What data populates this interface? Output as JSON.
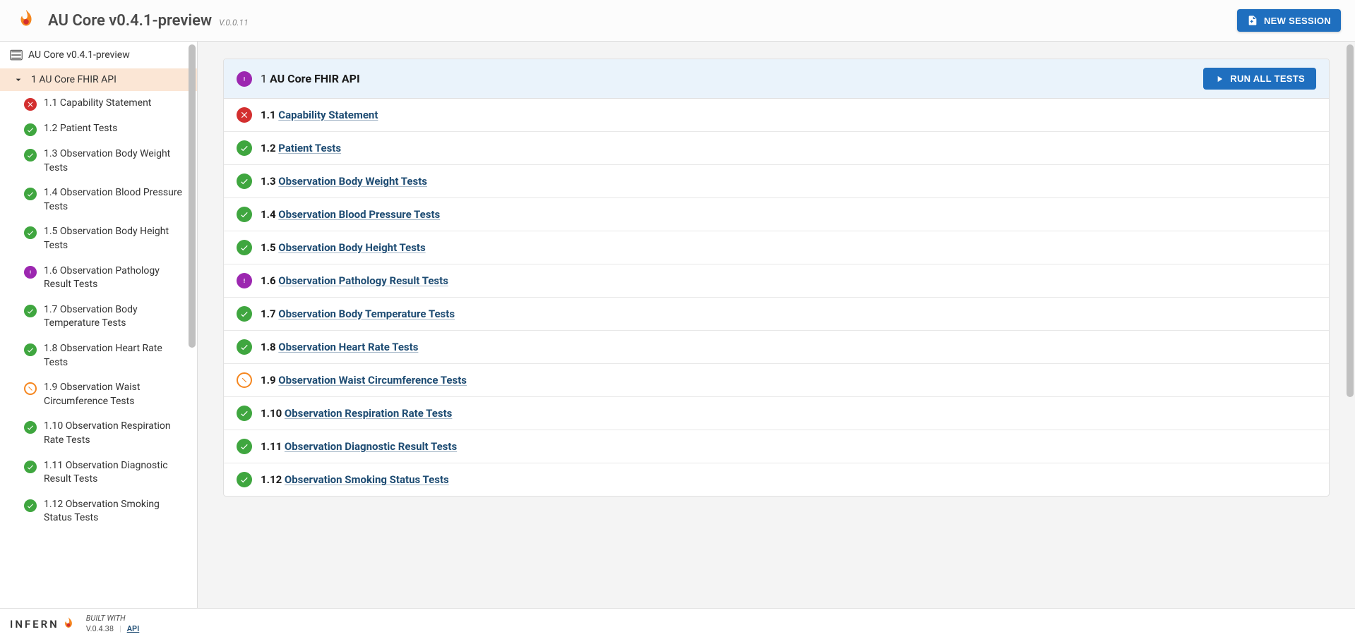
{
  "header": {
    "title": "AU Core v0.4.1-preview",
    "version": "V.0.0.11",
    "new_session": "NEW SESSION"
  },
  "sidebar": {
    "root": "AU Core v0.4.1-preview",
    "group": {
      "num": "1",
      "name": "AU Core FHIR API"
    },
    "items": [
      {
        "num": "1.1",
        "name": "Capability Statement",
        "status": "fail"
      },
      {
        "num": "1.2",
        "name": "Patient Tests",
        "status": "success"
      },
      {
        "num": "1.3",
        "name": "Observation Body Weight Tests",
        "status": "success"
      },
      {
        "num": "1.4",
        "name": "Observation Blood Pressure Tests",
        "status": "success"
      },
      {
        "num": "1.5",
        "name": "Observation Body Height Tests",
        "status": "success"
      },
      {
        "num": "1.6",
        "name": "Observation Pathology Result Tests",
        "status": "warn"
      },
      {
        "num": "1.7",
        "name": "Observation Body Temperature Tests",
        "status": "success"
      },
      {
        "num": "1.8",
        "name": "Observation Heart Rate Tests",
        "status": "success"
      },
      {
        "num": "1.9",
        "name": "Observation Waist Circumference Tests",
        "status": "skip"
      },
      {
        "num": "1.10",
        "name": "Observation Respiration Rate Tests",
        "status": "success"
      },
      {
        "num": "1.11",
        "name": "Observation Diagnostic Result Tests",
        "status": "success"
      },
      {
        "num": "1.12",
        "name": "Observation Smoking Status Tests",
        "status": "success"
      }
    ]
  },
  "main": {
    "header": {
      "num": "1",
      "name": "AU Core FHIR API",
      "status": "warn"
    },
    "run_button": "RUN ALL TESTS",
    "rows": [
      {
        "num": "1.1",
        "name": "Capability Statement",
        "status": "fail"
      },
      {
        "num": "1.2",
        "name": "Patient Tests",
        "status": "success"
      },
      {
        "num": "1.3",
        "name": "Observation Body Weight Tests",
        "status": "success"
      },
      {
        "num": "1.4",
        "name": "Observation Blood Pressure Tests",
        "status": "success"
      },
      {
        "num": "1.5",
        "name": "Observation Body Height Tests",
        "status": "success"
      },
      {
        "num": "1.6",
        "name": "Observation Pathology Result Tests",
        "status": "warn"
      },
      {
        "num": "1.7",
        "name": "Observation Body Temperature Tests",
        "status": "success"
      },
      {
        "num": "1.8",
        "name": "Observation Heart Rate Tests",
        "status": "success"
      },
      {
        "num": "1.9",
        "name": "Observation Waist Circumference Tests",
        "status": "skip"
      },
      {
        "num": "1.10",
        "name": "Observation Respiration Rate Tests",
        "status": "success"
      },
      {
        "num": "1.11",
        "name": "Observation Diagnostic Result Tests",
        "status": "success"
      },
      {
        "num": "1.12",
        "name": "Observation Smoking Status Tests",
        "status": "success"
      }
    ]
  },
  "footer": {
    "brand": "INFERN",
    "built_with": "BUILT WITH",
    "version": "V.0.4.38",
    "api": "API"
  }
}
